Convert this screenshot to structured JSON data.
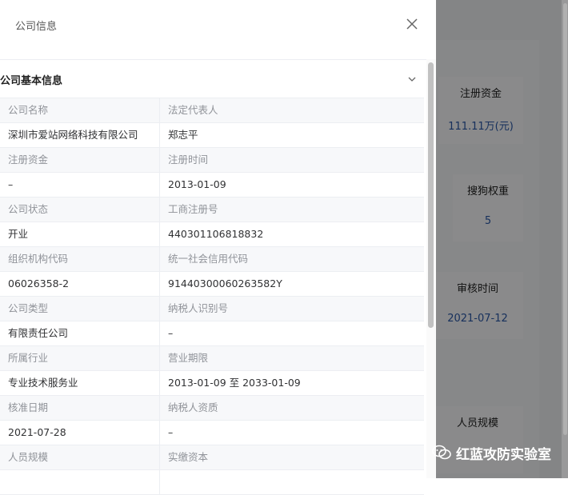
{
  "background": {
    "cards": [
      {
        "label": "注册资金",
        "value": "111.11万(元)"
      },
      {
        "label": "搜狗权重",
        "value": "5"
      },
      {
        "label": "审核时间",
        "value": "2021-07-12"
      },
      {
        "label": "人员规模",
        "value": ""
      }
    ]
  },
  "drawer": {
    "title": "公司信息",
    "section_title": "公司基本信息"
  },
  "table": {
    "rows": [
      {
        "l1": "公司名称",
        "l2": "法定代表人",
        "v1": "深圳市爱站网络科技有限公司",
        "v2": "郑志平"
      },
      {
        "l1": "注册资金",
        "l2": "注册时间",
        "v1": "–",
        "v2": "2013-01-09"
      },
      {
        "l1": "公司状态",
        "l2": "工商注册号",
        "v1": "开业",
        "v2": "440301106818832"
      },
      {
        "l1": "组织机构代码",
        "l2": "统一社会信用代码",
        "v1": "06026358-2",
        "v2": "91440300060263582Y"
      },
      {
        "l1": "公司类型",
        "l2": "纳税人识别号",
        "v1": "有限责任公司",
        "v2": "–"
      },
      {
        "l1": "所属行业",
        "l2": "营业期限",
        "v1": "专业技术服务业",
        "v2": "2013-01-09 至 2033-01-09"
      },
      {
        "l1": "核准日期",
        "l2": "纳税人资质",
        "v1": "2021-07-28",
        "v2": "–"
      },
      {
        "l1": "人员规模",
        "l2": "实缴资本",
        "v1": "",
        "v2": ""
      }
    ]
  },
  "watermark": {
    "text": "红蓝攻防实验室"
  }
}
